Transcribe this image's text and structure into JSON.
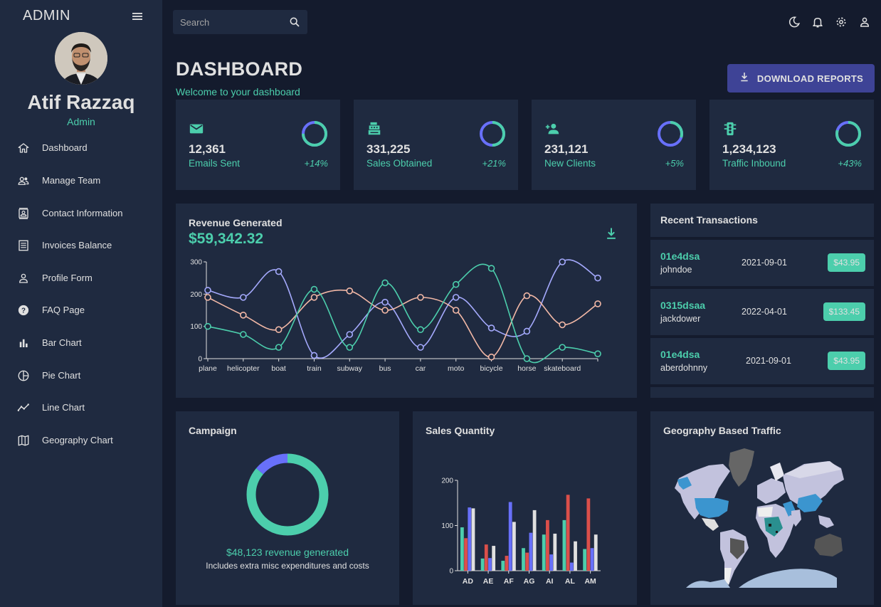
{
  "sidebar": {
    "brand": "ADMIN",
    "user_name": "Atif Razzaq",
    "user_role": "Admin",
    "items": [
      {
        "label": "Dashboard",
        "icon": "home-icon"
      },
      {
        "label": "Manage Team",
        "icon": "people-icon"
      },
      {
        "label": "Contact Information",
        "icon": "contacts-icon"
      },
      {
        "label": "Invoices Balance",
        "icon": "receipt-icon"
      },
      {
        "label": "Profile Form",
        "icon": "person-icon"
      },
      {
        "label": "FAQ Page",
        "icon": "help-icon"
      },
      {
        "label": "Bar Chart",
        "icon": "bar-chart-icon"
      },
      {
        "label": "Pie Chart",
        "icon": "pie-chart-icon"
      },
      {
        "label": "Line Chart",
        "icon": "timeline-icon"
      },
      {
        "label": "Geography Chart",
        "icon": "map-icon"
      }
    ]
  },
  "topbar": {
    "search_placeholder": "Search",
    "icons": [
      "dark-mode-icon",
      "notifications-icon",
      "settings-icon",
      "user-icon"
    ]
  },
  "header": {
    "title": "DASHBOARD",
    "subtitle": "Welcome to your dashboard",
    "download_label": "DOWNLOAD REPORTS"
  },
  "stats": [
    {
      "value": "12,361",
      "label": "Emails Sent",
      "increase": "+14%",
      "progress": 0.75,
      "icon": "email-icon"
    },
    {
      "value": "331,225",
      "label": "Sales Obtained",
      "increase": "+21%",
      "progress": 0.5,
      "icon": "point-of-sale-icon"
    },
    {
      "value": "231,121",
      "label": "New Clients",
      "increase": "+5%",
      "progress": 0.3,
      "icon": "person-add-icon"
    },
    {
      "value": "1,234,123",
      "label": "Traffic Inbound",
      "increase": "+43%",
      "progress": 0.8,
      "icon": "traffic-icon"
    }
  ],
  "revenue": {
    "title": "Revenue Generated",
    "amount": "$59,342.32"
  },
  "transactions": {
    "title": "Recent Transactions",
    "rows": [
      {
        "id": "01e4dsa",
        "user": "johndoe",
        "date": "2021-09-01",
        "cost": "$43.95"
      },
      {
        "id": "0315dsaa",
        "user": "jackdower",
        "date": "2022-04-01",
        "cost": "$133.45"
      },
      {
        "id": "01e4dsa",
        "user": "aberdohnny",
        "date": "2021-09-01",
        "cost": "$43.95"
      }
    ]
  },
  "campaign": {
    "title": "Campaign",
    "revenue_text": "$48,123 revenue generated",
    "note": "Includes extra misc expenditures and costs"
  },
  "sales": {
    "title": "Sales Quantity"
  },
  "geo": {
    "title": "Geography Based Traffic"
  },
  "colors": {
    "bg": "#141b2d",
    "panel": "#1f2a40",
    "accent": "#4cceac",
    "primary_button": "#3e4396",
    "ring_track": "#6870fa",
    "line_blue": "#a4a9fc",
    "line_red": "#f2b8a6",
    "line_green": "#4cceac"
  },
  "chart_data": [
    {
      "type": "line",
      "categories": [
        "plane",
        "helicopter",
        "boat",
        "train",
        "subway",
        "bus",
        "car",
        "moto",
        "bicycle",
        "horse",
        "skateboard"
      ],
      "ylim": [
        0,
        300
      ],
      "yticks": [
        "0",
        "100",
        "200",
        "300"
      ],
      "series": [
        {
          "color": "#a4a9fc",
          "values": [
            212,
            190,
            270,
            10,
            75,
            175,
            35,
            190,
            95,
            85,
            300,
            250
          ]
        },
        {
          "color": "#f2b8a6",
          "values": [
            190,
            135,
            90,
            190,
            210,
            150,
            190,
            150,
            5,
            195,
            105,
            170
          ]
        },
        {
          "color": "#4cceac",
          "values": [
            100,
            75,
            35,
            215,
            35,
            235,
            90,
            230,
            280,
            0,
            35,
            15
          ]
        }
      ]
    },
    {
      "type": "bar",
      "categories": [
        "AD",
        "AE",
        "AF",
        "AG",
        "AI",
        "AL",
        "AM"
      ],
      "ylim": [
        0,
        200
      ],
      "yticks": [
        "0",
        "100",
        "200"
      ],
      "series": [
        {
          "color": "#4cceac",
          "values": [
            96,
            27,
            22,
            50,
            80,
            112,
            48
          ]
        },
        {
          "color": "#db4f4a",
          "values": [
            72,
            58,
            33,
            40,
            112,
            168,
            160
          ]
        },
        {
          "color": "#6870fa",
          "values": [
            140,
            28,
            152,
            84,
            36,
            18,
            50
          ]
        },
        {
          "color": "#e0e0e0",
          "values": [
            138,
            55,
            108,
            134,
            82,
            65,
            80
          ]
        }
      ]
    },
    {
      "type": "pie",
      "slices": [
        {
          "color": "#4cceac",
          "value": 0.86
        },
        {
          "color": "#6870fa",
          "value": 0.14
        }
      ]
    }
  ]
}
